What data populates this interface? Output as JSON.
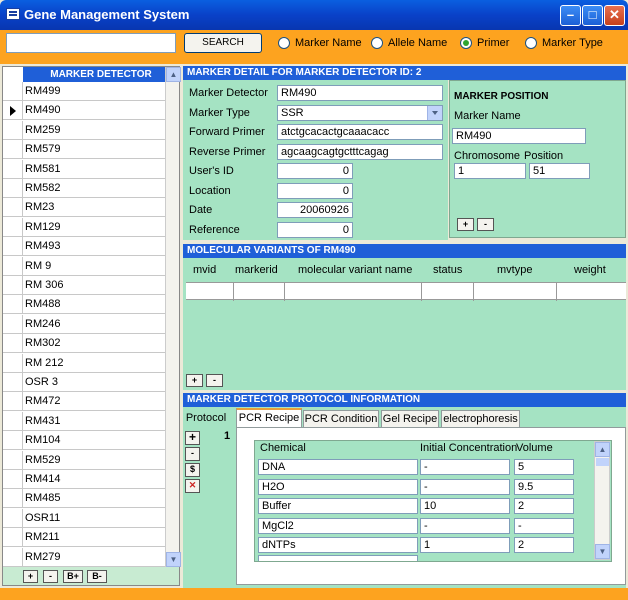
{
  "window": {
    "title": "Gene Management System"
  },
  "toolbar": {
    "search_value": "",
    "search_label": "SEARCH",
    "radios": [
      {
        "label": "Marker Name",
        "selected": false
      },
      {
        "label": "Allele Name",
        "selected": false
      },
      {
        "label": "Primer",
        "selected": true
      },
      {
        "label": "Marker Type",
        "selected": false
      }
    ]
  },
  "left_panel": {
    "header": "MARKER DETECTOR",
    "selected_index": 1,
    "items": [
      "RM499",
      "RM490",
      "RM259",
      "RM579",
      "RM581",
      "RM582",
      "RM23",
      "RM129",
      "RM493",
      "RM 9",
      "RM 306",
      "RM488",
      "RM246",
      "RM302",
      "RM 212",
      "OSR 3",
      "RM472",
      "RM431",
      "RM104",
      "RM529",
      "RM414",
      "RM485",
      "OSR11",
      "RM211",
      "RM279"
    ],
    "buttons": [
      "+",
      "-",
      "B+",
      "B-"
    ]
  },
  "detail": {
    "header": "MARKER DETAIL FOR MARKER DETECTOR ID: 2",
    "fields": {
      "marker_detector": {
        "label": "Marker Detector",
        "value": "RM490"
      },
      "marker_type": {
        "label": "Marker Type",
        "value": "SSR"
      },
      "forward_primer": {
        "label": "Forward Primer",
        "value": "atctgcacactgcaaacacc"
      },
      "reverse_primer": {
        "label": "Reverse Primer",
        "value": "agcaagcagtgctttcagag"
      },
      "users_id": {
        "label": "User's ID",
        "value": "0"
      },
      "location": {
        "label": "Location",
        "value": "0"
      },
      "date": {
        "label": "Date",
        "value": "20060926"
      },
      "reference": {
        "label": "Reference",
        "value": "0"
      }
    },
    "position": {
      "title": "MARKER POSITION",
      "marker_name_label": "Marker Name",
      "marker_name_value": "RM490",
      "chromosome_label": "Chromosome",
      "chromosome_value": "1",
      "position_label": "Position",
      "position_value": "51",
      "buttons": [
        "+",
        "-"
      ]
    }
  },
  "variants": {
    "header": "MOLECULAR VARIANTS OF     RM490",
    "columns": [
      "mvid",
      "markerid",
      "molecular variant name",
      "status",
      "mvtype",
      "weight"
    ],
    "buttons": [
      "+",
      "-"
    ]
  },
  "protocol": {
    "header": "MARKER DETECTOR PROTOCOL INFORMATION",
    "tabs": [
      "Protocol",
      "PCR Recipe",
      "PCR Condition",
      "Gel Recipe",
      "electrophoresis"
    ],
    "active_tab": "PCR Recipe",
    "record_number": "1",
    "side_buttons": [
      "+",
      "-",
      "$"
    ],
    "recipe_columns": [
      "Chemical",
      "Initial Concentration",
      "Volume"
    ],
    "recipe_rows": [
      {
        "chemical": "DNA",
        "initial": "-",
        "volume": "5"
      },
      {
        "chemical": "H2O",
        "initial": "-",
        "volume": "9.5"
      },
      {
        "chemical": "Buffer",
        "initial": "10",
        "volume": "2"
      },
      {
        "chemical": "MgCl2",
        "initial": "-",
        "volume": "-"
      },
      {
        "chemical": "dNTPs",
        "initial": "1",
        "volume": "2"
      }
    ]
  }
}
